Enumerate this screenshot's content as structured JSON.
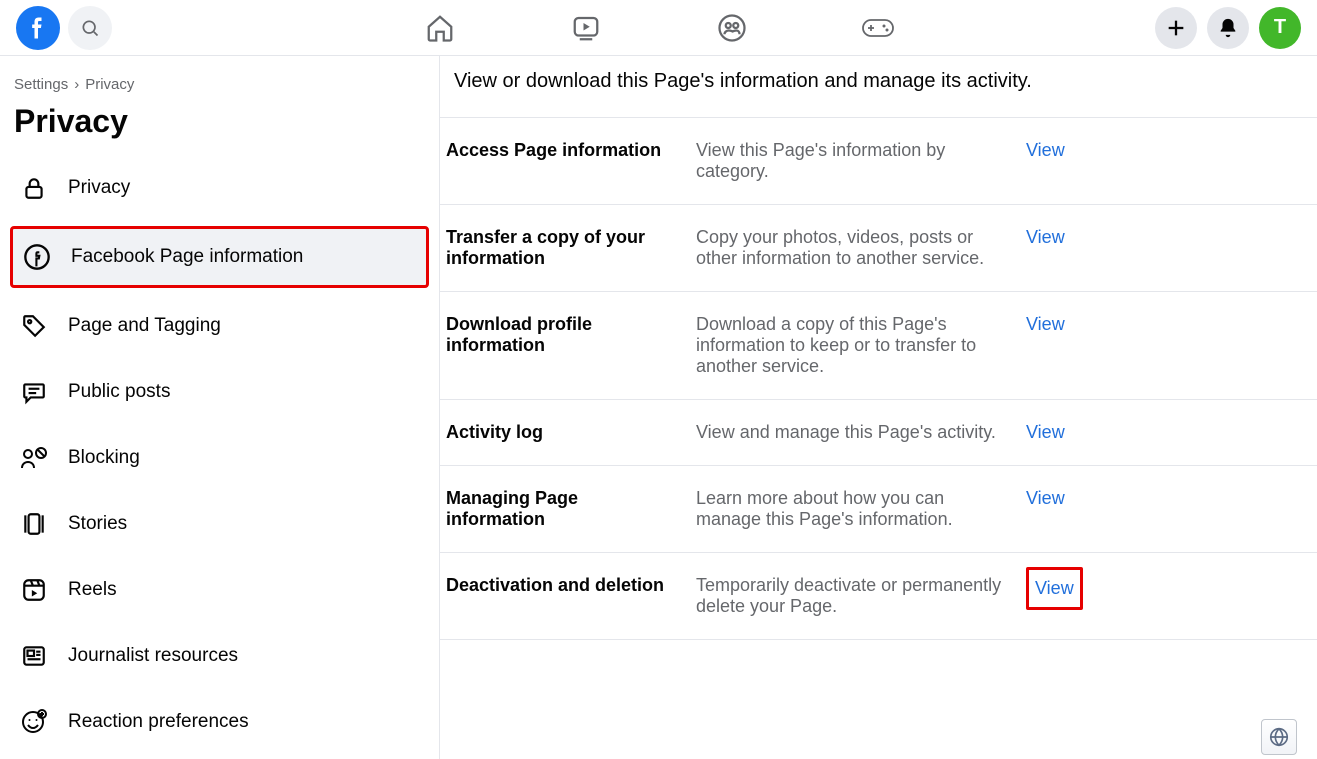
{
  "breadcrumb": {
    "root": "Settings",
    "sep": "›",
    "current": "Privacy"
  },
  "page_title": "Privacy",
  "avatar_initial": "T",
  "sidebar": {
    "items": [
      {
        "label": "Privacy"
      },
      {
        "label": "Facebook Page information"
      },
      {
        "label": "Page and Tagging"
      },
      {
        "label": "Public posts"
      },
      {
        "label": "Blocking"
      },
      {
        "label": "Stories"
      },
      {
        "label": "Reels"
      },
      {
        "label": "Journalist resources"
      },
      {
        "label": "Reaction preferences"
      }
    ]
  },
  "main": {
    "subtitle": "View or download this Page's information and manage its activity.",
    "rows": [
      {
        "label": "Access Page information",
        "desc": "View this Page's information by category.",
        "action": "View"
      },
      {
        "label": "Transfer a copy of your information",
        "desc": "Copy your photos, videos, posts or other information to another service.",
        "action": "View"
      },
      {
        "label": "Download profile information",
        "desc": "Download a copy of this Page's information to keep or to transfer to another service.",
        "action": "View"
      },
      {
        "label": "Activity log",
        "desc": "View and manage this Page's activity.",
        "action": "View"
      },
      {
        "label": "Managing Page information",
        "desc": "Learn more about how you can manage this Page's information.",
        "action": "View"
      },
      {
        "label": "Deactivation and deletion",
        "desc": "Temporarily deactivate or permanently delete your Page.",
        "action": "View"
      }
    ]
  }
}
